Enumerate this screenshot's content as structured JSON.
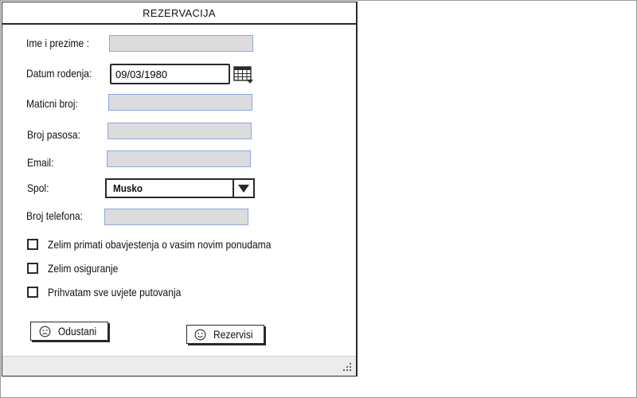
{
  "window": {
    "title": "REZERVACIJA"
  },
  "form": {
    "full_name": {
      "label": "Ime i prezime :",
      "value": ""
    },
    "birth_date": {
      "label": "Datum rodenja:",
      "value": "09/03/1980"
    },
    "id_number": {
      "label": "Maticni broj:",
      "value": ""
    },
    "passport": {
      "label": "Broj pasosa:",
      "value": ""
    },
    "email": {
      "label": "Email:",
      "value": ""
    },
    "gender": {
      "label": "Spol:",
      "selected": "Musko"
    },
    "phone": {
      "label": "Broj telefona:",
      "value": ""
    }
  },
  "checkboxes": [
    {
      "label": "Zelim primati obavjestenja o vasim novim ponudama",
      "checked": false
    },
    {
      "label": "Zelim osiguranje",
      "checked": false
    },
    {
      "label": "Prihvatam sve uvjete putovanja",
      "checked": false
    }
  ],
  "buttons": {
    "cancel": {
      "label": "Odustani",
      "icon": "sad-face-icon"
    },
    "submit": {
      "label": "Rezervisi",
      "icon": "smiley-face-icon"
    }
  },
  "colors": {
    "field_fill": "#dcdcdc",
    "field_border": "#8fa6e8",
    "outline": "#2a2a2a"
  }
}
